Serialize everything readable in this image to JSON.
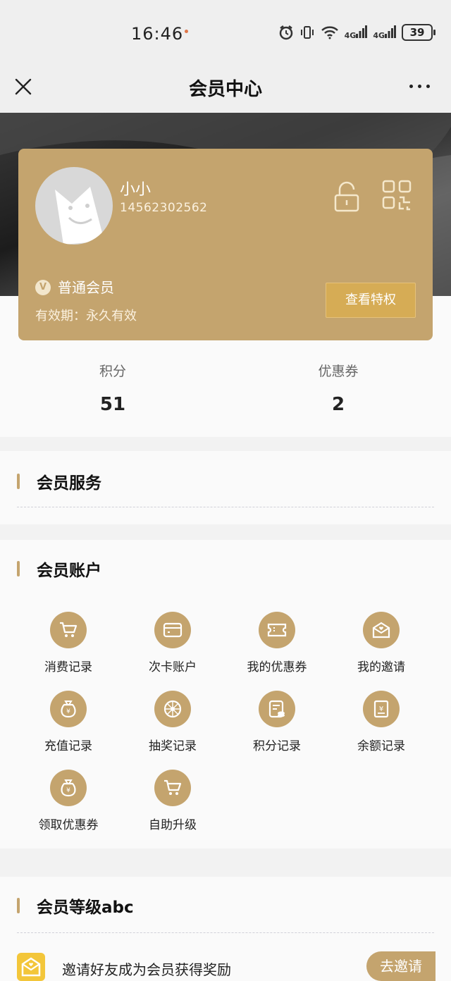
{
  "status_bar": {
    "time": "16:46",
    "battery": "39",
    "signal_1": "4G",
    "signal_2": "4G"
  },
  "nav": {
    "title": "会员中心"
  },
  "card": {
    "name": "小小",
    "phone": "14562302562",
    "level_badge": "V",
    "level_name": "普通会员",
    "validity": "有效期：永久有效",
    "privilege_button": "查看特权"
  },
  "stats": [
    {
      "label": "积分",
      "value": "51"
    },
    {
      "label": "优惠券",
      "value": "2"
    }
  ],
  "sections": {
    "services": {
      "title": "会员服务"
    },
    "account": {
      "title": "会员账户",
      "items": [
        {
          "label": "消费记录",
          "icon": "cart-icon"
        },
        {
          "label": "次卡账户",
          "icon": "card-icon"
        },
        {
          "label": "我的优惠券",
          "icon": "ticket-icon"
        },
        {
          "label": "我的邀请",
          "icon": "envelope-icon"
        },
        {
          "label": "充值记录",
          "icon": "money-bag-icon"
        },
        {
          "label": "抽奖记录",
          "icon": "wheel-icon"
        },
        {
          "label": "积分记录",
          "icon": "points-icon"
        },
        {
          "label": "余额记录",
          "icon": "receipt-icon"
        },
        {
          "label": "领取优惠券",
          "icon": "money-bag-icon"
        },
        {
          "label": "自助升级",
          "icon": "cart-icon"
        }
      ]
    },
    "levels": {
      "title": "会员等级abc"
    }
  },
  "invite": {
    "text": "邀请好友成为会员获得奖励",
    "button": "去邀请"
  },
  "colors": {
    "gold": "#c4a46e",
    "button_gold": "#d6ac55",
    "invite_yellow": "#f3c63a"
  }
}
